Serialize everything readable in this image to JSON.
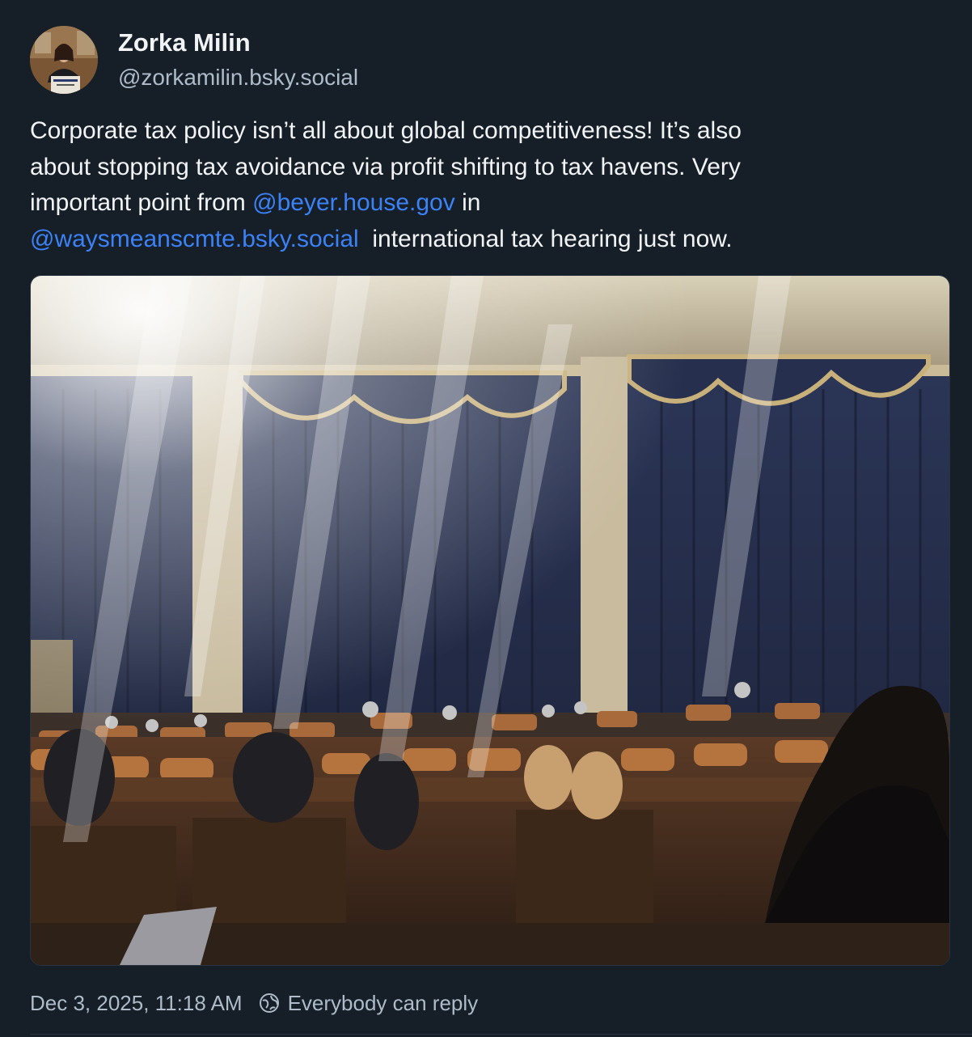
{
  "author": {
    "display_name": "Zorka Milin",
    "handle": "@zorkamilin.bsky.social",
    "avatar_icon": "profile-photo"
  },
  "post": {
    "text_lines": [
      [
        {
          "t": "Corporate tax policy isn’t all about global competitiveness! It’s also"
        }
      ],
      [
        {
          "t": "about stopping tax avoidance via profit shifting to tax havens. Very"
        }
      ],
      [
        {
          "t": "important point from "
        },
        {
          "t": "@beyer.house.gov",
          "mention": true
        },
        {
          "t": " in"
        }
      ],
      [
        {
          "t": "@waysmeanscmte.bsky.social",
          "mention": true
        },
        {
          "t": "  international tax hearing just now."
        }
      ]
    ]
  },
  "image": {
    "description_icon": "hearing-room-photo"
  },
  "meta": {
    "timestamp": "Dec 3, 2025, 11:18 AM",
    "reply_icon": "globe-icon",
    "reply_setting": "Everybody can reply"
  },
  "colors": {
    "background": "#161e27",
    "text": "#f1f3f5",
    "muted": "#aebbc9",
    "link": "#3b82f6"
  }
}
